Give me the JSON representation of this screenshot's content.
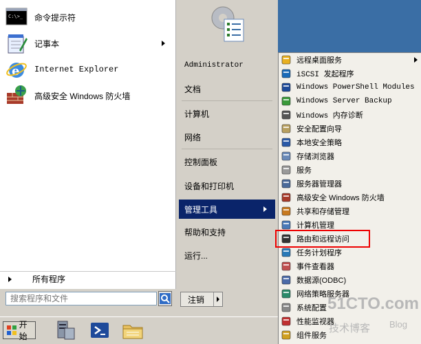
{
  "pinned": [
    {
      "label": "命令提示符",
      "icon": "command-prompt-icon"
    },
    {
      "label": "记事本",
      "icon": "notepad-icon",
      "has_submenu": true
    },
    {
      "label": "Internet Explorer",
      "icon": "internet-explorer-icon"
    },
    {
      "label": "高级安全 Windows 防火墙",
      "icon": "firewall-icon"
    }
  ],
  "all_programs": "所有程序",
  "search": {
    "placeholder": "搜索程序和文件",
    "value": ""
  },
  "right_menu": [
    {
      "label": "Administrator"
    },
    {
      "label": "文档"
    },
    {
      "label": "计算机"
    },
    {
      "label": "网络"
    },
    {
      "label": "控制面板"
    },
    {
      "label": "设备和打印机"
    },
    {
      "label": "管理工具",
      "has_submenu": true,
      "active": true
    },
    {
      "label": "帮助和支持"
    },
    {
      "label": "运行..."
    }
  ],
  "shutdown_label": "注销",
  "start_label": "开始",
  "admin_tools": [
    {
      "label": "远程桌面服务",
      "has_submenu": true
    },
    {
      "label": "iSCSI 发起程序"
    },
    {
      "label": "Windows PowerShell Modules"
    },
    {
      "label": "Windows Server Backup"
    },
    {
      "label": "Windows 内存诊断"
    },
    {
      "label": "安全配置向导"
    },
    {
      "label": "本地安全策略"
    },
    {
      "label": "存储浏览器"
    },
    {
      "label": "服务"
    },
    {
      "label": "服务器管理器"
    },
    {
      "label": "高级安全 Windows 防火墙"
    },
    {
      "label": "共享和存储管理"
    },
    {
      "label": "计算机管理"
    },
    {
      "label": "路由和远程访问",
      "highlighted": true
    },
    {
      "label": "任务计划程序"
    },
    {
      "label": "事件查看器"
    },
    {
      "label": "数据源(ODBC)"
    },
    {
      "label": "网络策略服务器"
    },
    {
      "label": "系统配置"
    },
    {
      "label": "性能监视器"
    },
    {
      "label": "组件服务"
    }
  ],
  "watermark": {
    "main": "51CTO.com",
    "sub": "技术博客",
    "blog": "Blog"
  },
  "colors": {
    "active": "#0a246a",
    "highlight_box": "#e00000",
    "desktop": "#3a6ea5"
  }
}
